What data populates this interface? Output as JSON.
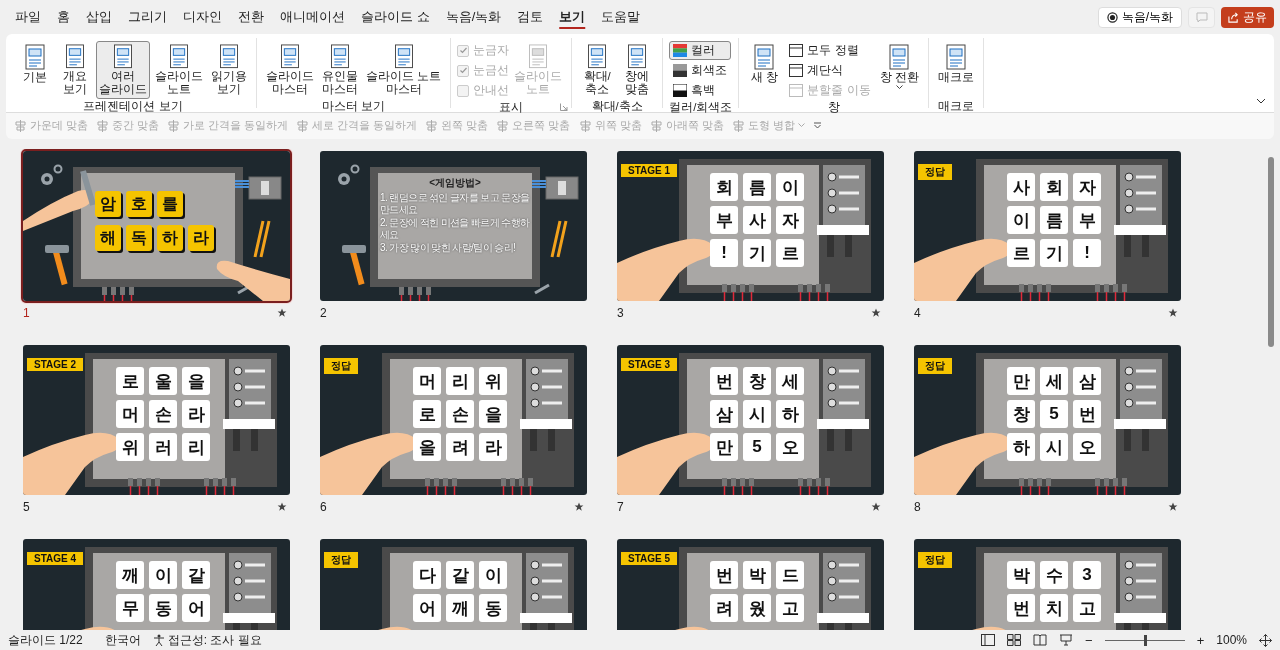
{
  "tabs": [
    {
      "label": "파일",
      "selected": false
    },
    {
      "label": "홈",
      "selected": false
    },
    {
      "label": "삽입",
      "selected": false
    },
    {
      "label": "그리기",
      "selected": false
    },
    {
      "label": "디자인",
      "selected": false
    },
    {
      "label": "전환",
      "selected": false
    },
    {
      "label": "애니메이션",
      "selected": false
    },
    {
      "label": "슬라이드 쇼",
      "selected": false
    },
    {
      "label": "녹음/녹화",
      "selected": false
    },
    {
      "label": "검토",
      "selected": false
    },
    {
      "label": "보기",
      "selected": true
    },
    {
      "label": "도움말",
      "selected": false
    }
  ],
  "header_buttons": {
    "record": "녹음/녹화",
    "share": "공유"
  },
  "ribbon_groups": [
    {
      "label": "프레젠테이션 보기",
      "items": [
        {
          "kind": "large",
          "label": "기본",
          "selected": false,
          "disabled": false
        },
        {
          "kind": "large",
          "label": "개요\n보기",
          "selected": false,
          "disabled": false
        },
        {
          "kind": "large",
          "label": "여러\n슬라이드",
          "selected": true,
          "disabled": false
        },
        {
          "kind": "large",
          "label": "슬라이드\n노트",
          "selected": false,
          "disabled": false
        },
        {
          "kind": "large",
          "label": "읽기용\n보기",
          "selected": false,
          "disabled": false
        }
      ]
    },
    {
      "label": "마스터 보기",
      "items": [
        {
          "kind": "large",
          "label": "슬라이드\n마스터",
          "selected": false,
          "disabled": false
        },
        {
          "kind": "large",
          "label": "유인물\n마스터",
          "selected": false,
          "disabled": false
        },
        {
          "kind": "large",
          "label": "슬라이드 노트\n마스터",
          "selected": false,
          "disabled": false
        }
      ]
    },
    {
      "label": "표시",
      "launcher": true,
      "items": [
        {
          "kind": "check",
          "label": "눈금자",
          "checked": true,
          "disabled": true
        },
        {
          "kind": "check",
          "label": "눈금선",
          "checked": true,
          "disabled": true
        },
        {
          "kind": "check",
          "label": "안내선",
          "checked": false,
          "disabled": true
        },
        {
          "kind": "large",
          "label": "슬라이드\n노트",
          "selected": false,
          "disabled": true
        }
      ]
    },
    {
      "label": "확대/축소",
      "items": [
        {
          "kind": "large",
          "label": "확대/\n축소",
          "selected": false,
          "disabled": false
        },
        {
          "kind": "large",
          "label": "창에\n맞춤",
          "selected": false,
          "disabled": false
        }
      ]
    },
    {
      "label": "컬러/회색조",
      "items": [
        {
          "kind": "swatch",
          "label": "컬러",
          "selected": true,
          "disabled": false
        },
        {
          "kind": "swatch",
          "label": "회색조",
          "selected": false,
          "disabled": false
        },
        {
          "kind": "swatch",
          "label": "흑백",
          "selected": false,
          "disabled": false
        }
      ]
    },
    {
      "label": "창",
      "items": [
        {
          "kind": "large",
          "label": "새 창",
          "selected": false,
          "disabled": false
        },
        {
          "kind": "small",
          "label": "모두 정렬",
          "disabled": false
        },
        {
          "kind": "small",
          "label": "계단식",
          "disabled": false
        },
        {
          "kind": "small",
          "label": "분할줄 이동",
          "disabled": true
        },
        {
          "kind": "large",
          "label": "창 전환",
          "selected": false,
          "disabled": false,
          "dropdown": true
        }
      ]
    },
    {
      "label": "매크로",
      "items": [
        {
          "kind": "large",
          "label": "매크로",
          "selected": false,
          "disabled": false
        }
      ]
    }
  ],
  "arrange_toolbar": [
    {
      "label": "가운데 맞춤",
      "disabled": true
    },
    {
      "label": "중간 맞춤",
      "disabled": true
    },
    {
      "label": "가로 간격을 동일하게",
      "disabled": true
    },
    {
      "label": "세로 간격을 동일하게",
      "disabled": true
    },
    {
      "label": "왼쪽 맞춤",
      "disabled": true
    },
    {
      "label": "오른쪽 맞춤",
      "disabled": true
    },
    {
      "label": "위쪽 맞춤",
      "disabled": true
    },
    {
      "label": "아래쪽 맞춤",
      "disabled": true
    },
    {
      "label": "도형 병합",
      "disabled": true,
      "dropdown": true
    }
  ],
  "slides": [
    {
      "number": "1",
      "selected": true,
      "animated": true,
      "kind": "title",
      "tiles": [
        [
          "암",
          "호",
          "를"
        ],
        [
          "해",
          "독",
          "하",
          "라"
        ]
      ]
    },
    {
      "number": "2",
      "selected": false,
      "kind": "text",
      "heading": "<게임방법>",
      "lines": [
        "1. 랜덤으로 섞인 글자를 보고 문장을 만드세요",
        "2. 문장에 적힌 미션을 빠르게 수행하세요",
        "3. 가장 많이 맞힌 사람/팀이 승리!"
      ]
    },
    {
      "number": "3",
      "selected": false,
      "animated": true,
      "kind": "puzzle",
      "badge": "STAGE 1",
      "tiles": [
        [
          "회",
          "름",
          "이"
        ],
        [
          "부",
          "사",
          "자"
        ],
        [
          "!",
          "기",
          "르"
        ]
      ]
    },
    {
      "number": "4",
      "selected": false,
      "animated": true,
      "kind": "puzzle",
      "badge": "정답",
      "tiles": [
        [
          "사",
          "회",
          "자"
        ],
        [
          "이",
          "름",
          "부"
        ],
        [
          "르",
          "기",
          "!"
        ]
      ]
    },
    {
      "number": "5",
      "selected": false,
      "animated": true,
      "kind": "puzzle",
      "badge": "STAGE 2",
      "tiles": [
        [
          "로",
          "울",
          "을"
        ],
        [
          "머",
          "손",
          "라"
        ],
        [
          "위",
          "러",
          "리"
        ]
      ]
    },
    {
      "number": "6",
      "selected": false,
      "animated": true,
      "kind": "puzzle",
      "badge": "정답",
      "tiles": [
        [
          "머",
          "리",
          "위"
        ],
        [
          "로",
          "손",
          "을"
        ],
        [
          "올",
          "려",
          "라"
        ]
      ]
    },
    {
      "number": "7",
      "selected": false,
      "animated": true,
      "kind": "puzzle",
      "badge": "STAGE 3",
      "tiles": [
        [
          "번",
          "창",
          "세"
        ],
        [
          "삼",
          "시",
          "하"
        ],
        [
          "만",
          "5",
          "오"
        ]
      ]
    },
    {
      "number": "8",
      "selected": false,
      "animated": true,
      "kind": "puzzle",
      "badge": "정답",
      "tiles": [
        [
          "만",
          "세",
          "삼"
        ],
        [
          "창",
          "5",
          "번"
        ],
        [
          "하",
          "시",
          "오"
        ]
      ]
    },
    {
      "selected": false,
      "kind": "puzzle",
      "badge": "STAGE 4",
      "tiles": [
        [
          "깨",
          "이",
          "같"
        ],
        [
          "무",
          "동",
          "어"
        ]
      ]
    },
    {
      "selected": false,
      "kind": "puzzle",
      "badge": "정답",
      "tiles": [
        [
          "다",
          "같",
          "이"
        ],
        [
          "어",
          "깨",
          "동"
        ]
      ]
    },
    {
      "selected": false,
      "kind": "puzzle",
      "badge": "STAGE 5",
      "tiles": [
        [
          "번",
          "박",
          "드"
        ],
        [
          "려",
          "웠",
          "고"
        ]
      ]
    },
    {
      "selected": false,
      "kind": "puzzle",
      "badge": "정답",
      "tiles": [
        [
          "박",
          "수",
          "3"
        ],
        [
          "번",
          "치",
          "고"
        ]
      ]
    }
  ],
  "status_bar": {
    "slide": "슬라이드 1/22",
    "language": "한국어",
    "accessibility": "접근성: 조사 필요",
    "zoom_out": "−",
    "zoom_in": "+",
    "zoom": "100%",
    "zoom_level": {
      "level": 0.5
    }
  }
}
